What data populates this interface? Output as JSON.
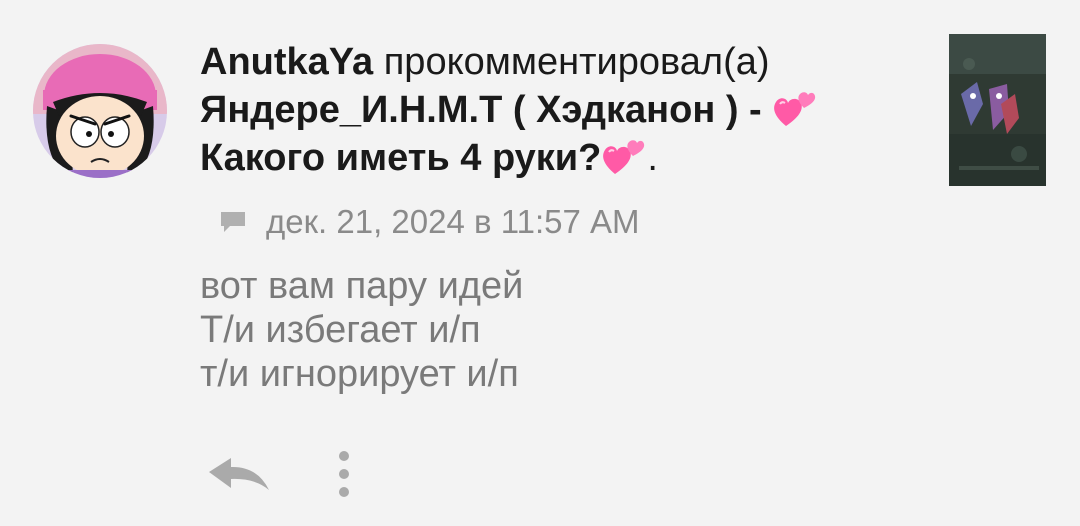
{
  "notification": {
    "username": "AnutkaYa",
    "action": "прокомментировал(а)",
    "post_title_line1": "Яндере_И.Н.М.Т ( Хэдканон ) -",
    "post_title_line2": "Какого иметь 4 руки?",
    "trailing_dot": ".",
    "heart_icon": "two-hearts-icon",
    "heart_color": "#ff5aa6"
  },
  "meta": {
    "icon": "comment-icon",
    "date": "дек. 21, 2024 в 11:57 AM"
  },
  "comment": {
    "lines": [
      "вот вам пару идей",
      "Т/и избегает и/п",
      "т/и игнорирует и/п"
    ]
  },
  "actions": {
    "reply_icon": "reply-arrow-icon",
    "more_icon": "vertical-dots-icon"
  },
  "colors": {
    "background": "#f3f3f3",
    "title_text": "#1a1a1a",
    "secondary_text": "#8a8a8a",
    "body_text": "#7a7a7a",
    "icon_gray": "#aaaaaa",
    "avatar_ring": "#cfc3e8"
  }
}
